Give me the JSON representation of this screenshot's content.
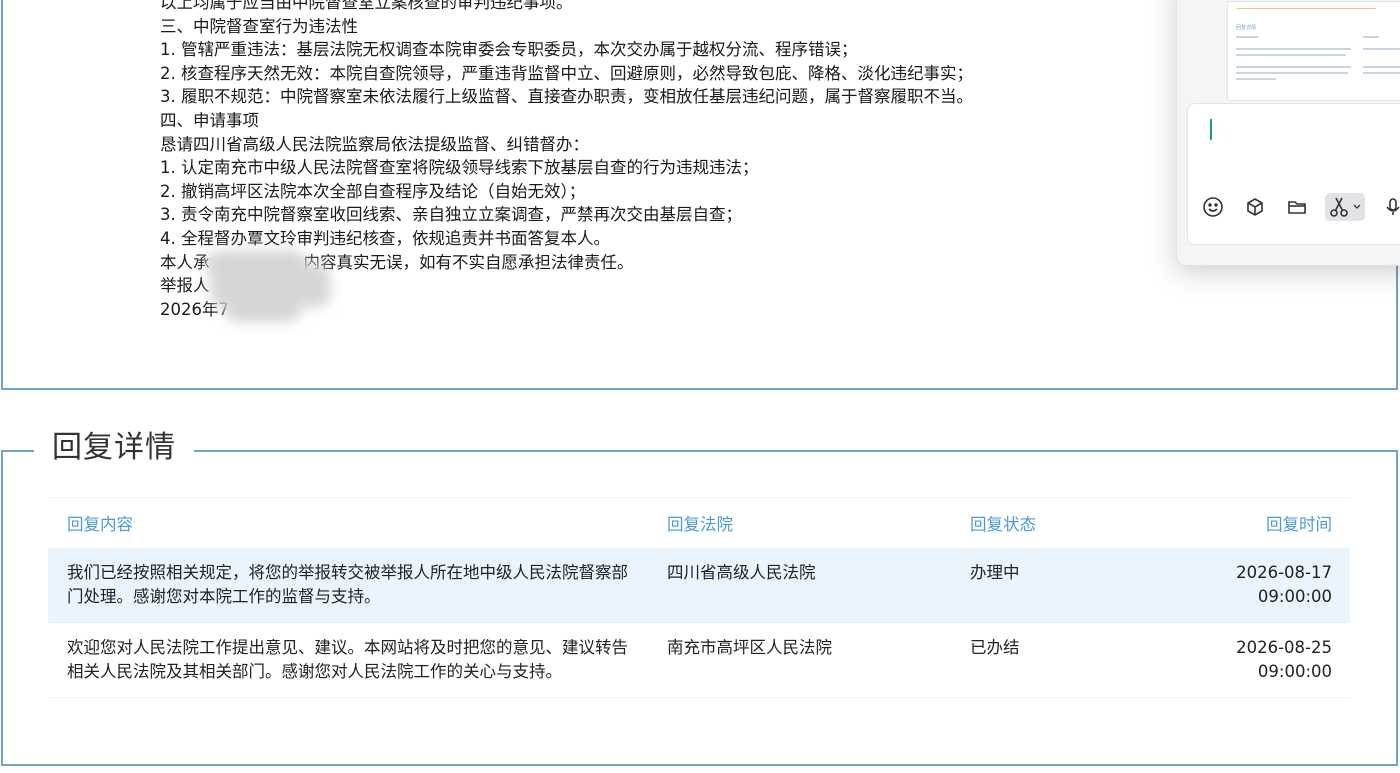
{
  "complaint": {
    "lines": [
      "以上均属于应当由中院督查室立案核查的审判违纪事项。",
      "三、中院督查室行为违法性",
      "1. 管辖严重违法：基层法院无权调查本院审委会专职委员，本次交办属于越权分流、程序错误；",
      "2. 核查程序天然无效：本院自查院领导，严重违背监督中立、回避原则，必然导致包庇、降格、淡化违纪事实；",
      "3. 履职不规范：中院督察室未依法履行上级监督、直接查办职责，变相放任基层违纪问题，属于督察履职不当。",
      "四、申请事项",
      "恳请四川省高级人民法院监察局依法提级监督、纠错督办：",
      "1. 认定南充市中级人民法院督查室将院级领导线索下放基层自查的行为违规违法；",
      "2. 撤销高坪区法院本次全部自查程序及结论（自始无效）；",
      "3. 责令南充中院督察室收回线索、亲自独立立案调查，严禁再次交由基层自查；",
      "4. 全程督办覃文玲审判违纪核查，依规追责并书面答复本人。"
    ],
    "pledge_prefix": "本人承",
    "pledge_suffix": "内容真实无误，如有不实自愿承担法律责任。",
    "reporter_label": "举报人",
    "date_prefix": "2026年7"
  },
  "chat": {
    "preview_title": "回复详情",
    "tools": [
      "emoji-icon",
      "cube-icon",
      "folder-icon",
      "scissors-icon",
      "microphone-icon"
    ]
  },
  "reply": {
    "section_title": "回复详情",
    "headers": {
      "content": "回复内容",
      "court": "回复法院",
      "status": "回复状态",
      "time": "回复时间"
    },
    "rows": [
      {
        "content": "我们已经按照相关规定，将您的举报转交被举报人所在地中级人民法院督察部门处理。感谢您对本院工作的监督与支持。",
        "court": "四川省高级人民法院",
        "status": "办理中",
        "time": "2026-08-17 09:00:00"
      },
      {
        "content": "欢迎您对人民法院工作提出意见、建议。本网站将及时把您的意见、建议转告相关人民法院及其相关部门。感谢您对人民法院工作的关心与支持。",
        "court": "南充市高坪区人民法院",
        "status": "已办结",
        "time": "2026-08-25 09:00:00"
      }
    ]
  },
  "colors": {
    "border": "#6fa5c4",
    "header_text": "#4b9bd1",
    "row_highlight": "#eaf4fd"
  }
}
